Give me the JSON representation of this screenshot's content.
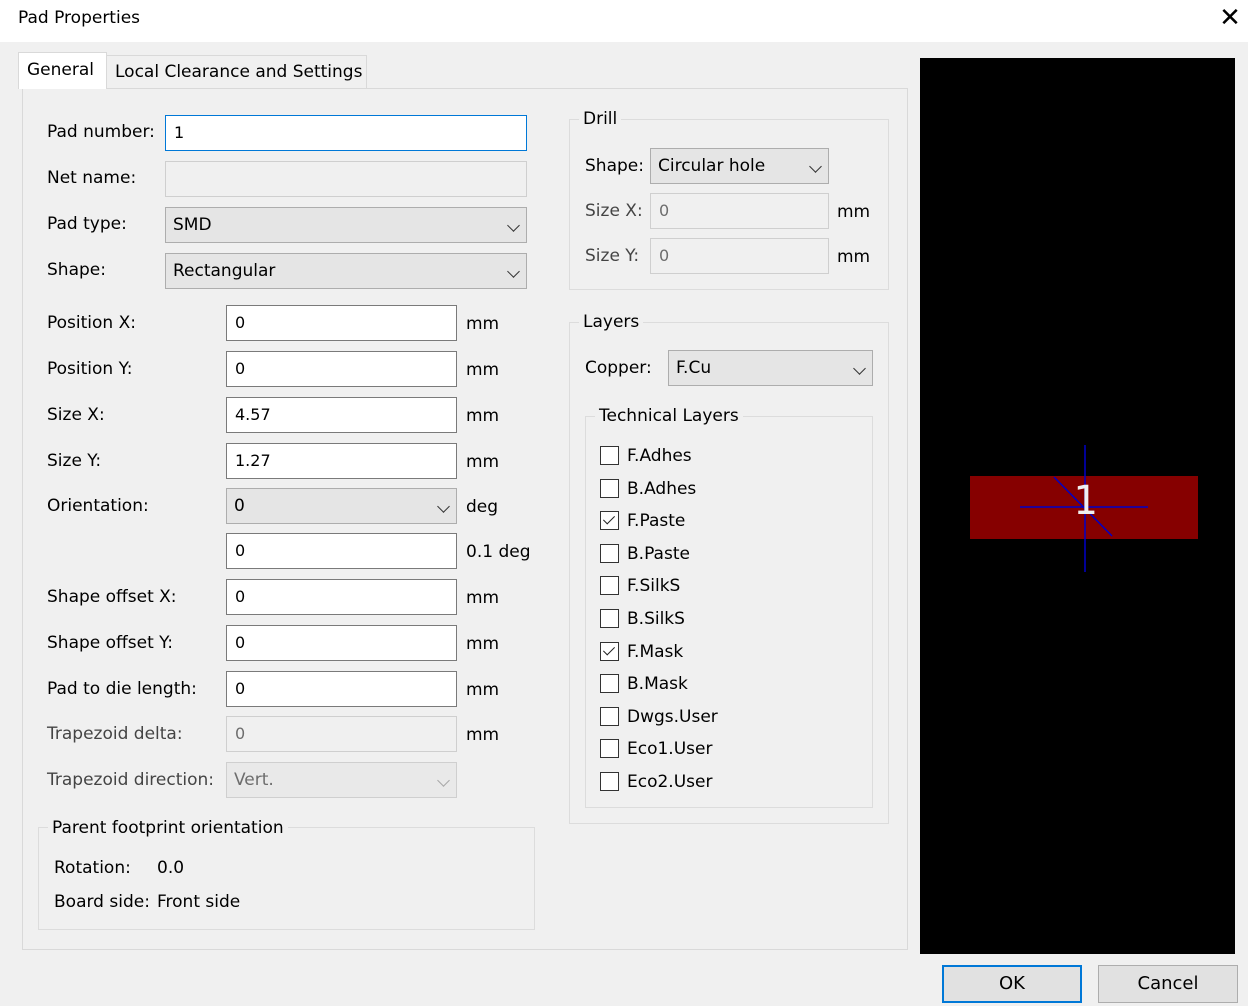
{
  "window": {
    "title": "Pad Properties"
  },
  "tabs": [
    {
      "label": "General"
    },
    {
      "label": "Local Clearance and Settings"
    }
  ],
  "general": {
    "pad_number": {
      "label": "Pad number:",
      "value": "1"
    },
    "net_name": {
      "label": "Net name:",
      "value": ""
    },
    "pad_type": {
      "label": "Pad type:",
      "value": "SMD"
    },
    "shape": {
      "label": "Shape:",
      "value": "Rectangular"
    },
    "position_x": {
      "label": "Position X:",
      "value": "0",
      "unit": "mm"
    },
    "position_y": {
      "label": "Position Y:",
      "value": "0",
      "unit": "mm"
    },
    "size_x": {
      "label": "Size X:",
      "value": "4.57",
      "unit": "mm"
    },
    "size_y": {
      "label": "Size Y:",
      "value": "1.27",
      "unit": "mm"
    },
    "orientation": {
      "label": "Orientation:",
      "value": "0",
      "unit": "deg",
      "fine_value": "0",
      "fine_unit": "0.1 deg"
    },
    "shape_offset_x": {
      "label": "Shape offset X:",
      "value": "0",
      "unit": "mm"
    },
    "shape_offset_y": {
      "label": "Shape offset Y:",
      "value": "0",
      "unit": "mm"
    },
    "pad_to_die": {
      "label": "Pad to die length:",
      "value": "0",
      "unit": "mm"
    },
    "trapezoid_delta": {
      "label": "Trapezoid delta:",
      "value": "0",
      "unit": "mm"
    },
    "trapezoid_direction": {
      "label": "Trapezoid direction:",
      "value": "Vert."
    },
    "parent": {
      "title": "Parent footprint orientation",
      "rotation_label": "Rotation:",
      "rotation_value": "0.0",
      "side_label": "Board side:",
      "side_value": "Front side"
    }
  },
  "drill": {
    "title": "Drill",
    "shape_label": "Shape:",
    "shape_value": "Circular hole",
    "size_x_label": "Size X:",
    "size_x_value": "0",
    "size_x_unit": "mm",
    "size_y_label": "Size Y:",
    "size_y_value": "0",
    "size_y_unit": "mm"
  },
  "layers": {
    "title": "Layers",
    "copper_label": "Copper:",
    "copper_value": "F.Cu",
    "technical_title": "Technical Layers",
    "items": [
      {
        "label": "F.Adhes",
        "checked": false
      },
      {
        "label": "B.Adhes",
        "checked": false
      },
      {
        "label": "F.Paste",
        "checked": true
      },
      {
        "label": "B.Paste",
        "checked": false
      },
      {
        "label": "F.SilkS",
        "checked": false
      },
      {
        "label": "B.SilkS",
        "checked": false
      },
      {
        "label": "F.Mask",
        "checked": true
      },
      {
        "label": "B.Mask",
        "checked": false
      },
      {
        "label": "Dwgs.User",
        "checked": false
      },
      {
        "label": "Eco1.User",
        "checked": false
      },
      {
        "label": "Eco2.User",
        "checked": false
      }
    ]
  },
  "preview": {
    "pad_label": "1",
    "pad_color": "#860000",
    "crosshair_color": "#0000c8"
  },
  "buttons": {
    "ok": "OK",
    "cancel": "Cancel"
  }
}
